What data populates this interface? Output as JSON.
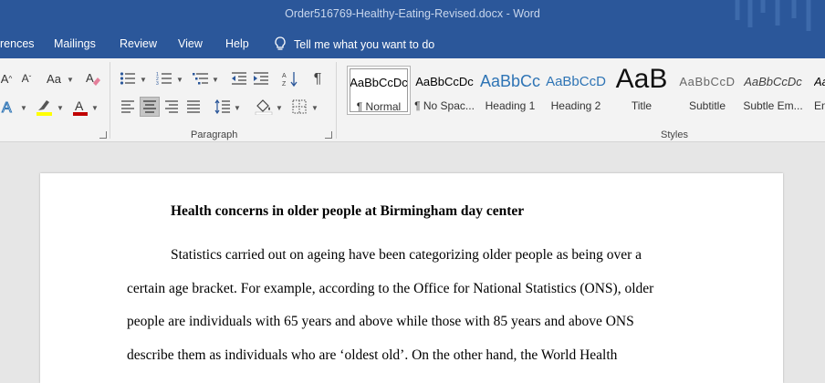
{
  "window": {
    "title": "Order516769-Healthy-Eating-Revised.docx  -  Word"
  },
  "tabs": [
    "rences",
    "Mailings",
    "Review",
    "View",
    "Help"
  ],
  "tell_me": "Tell me what you want to do",
  "ribbon": {
    "font_buttons": {
      "grow": "A",
      "shrink": "A",
      "case": "Aa"
    },
    "groups": {
      "paragraph": "Paragraph",
      "styles": "Styles"
    }
  },
  "styles": [
    {
      "preview": "AaBbCcDc",
      "name": "¶ Normal"
    },
    {
      "preview": "AaBbCcDc",
      "name": "¶ No Spac..."
    },
    {
      "preview": "AaBbCc",
      "name": "Heading 1"
    },
    {
      "preview": "AaBbCcD",
      "name": "Heading 2"
    },
    {
      "preview": "AaB",
      "name": "Title"
    },
    {
      "preview": "AaBbCcD",
      "name": "Subtitle"
    },
    {
      "preview": "AaBbCcDc",
      "name": "Subtle Em..."
    },
    {
      "preview": "AaBbCcDc",
      "name": "Em"
    }
  ],
  "document": {
    "heading": "Health concerns in older people at Birmingham day center",
    "lines": [
      "Statistics carried out on ageing have been categorizing older people as being over a",
      "certain age bracket. For example, according to the Office for National Statistics (ONS), older",
      "people are individuals with 65 years and above while those with 85 years and above ONS",
      "describe them as individuals who are ‘oldest old’. On the other hand, the World Health"
    ]
  },
  "colors": {
    "ribbon_blue": "#2b579a",
    "heading_style": "#2e74b5",
    "font_color_red": "#c00000",
    "highlight_yellow": "#ffff00"
  }
}
